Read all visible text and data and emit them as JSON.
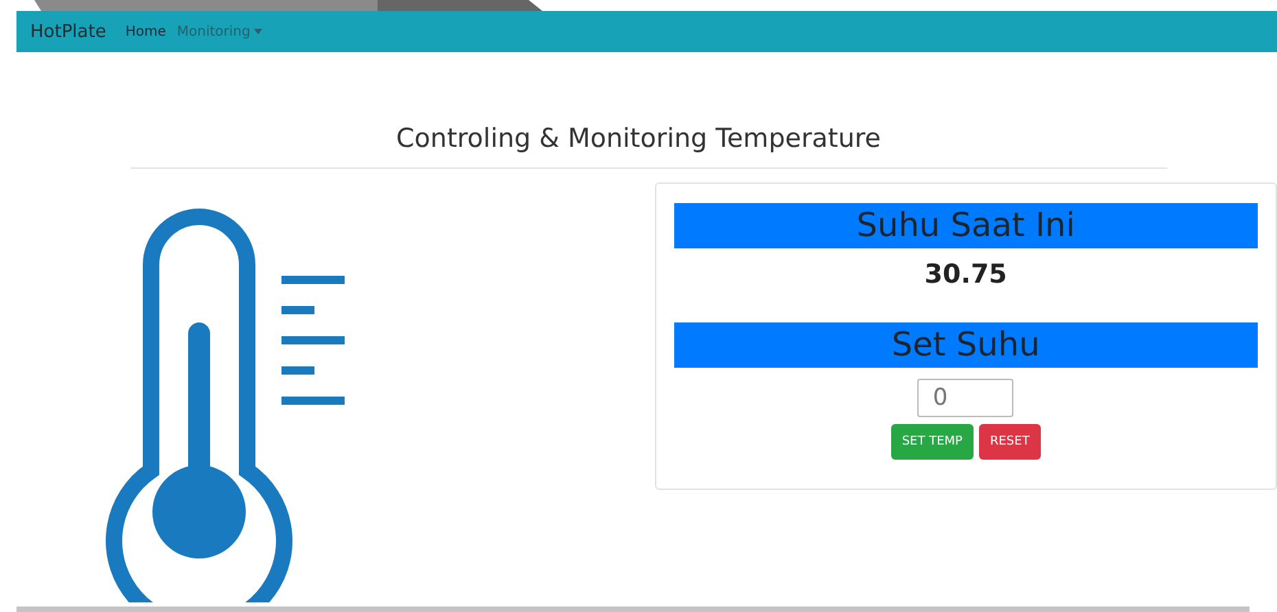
{
  "navbar": {
    "brand": "HotPlate",
    "items": [
      {
        "label": "Home",
        "selected": true,
        "dropdown": false
      },
      {
        "label": "Monitoring",
        "selected": false,
        "dropdown": true
      }
    ]
  },
  "heading": "Controling & Monitoring Temperature",
  "current": {
    "title": "Suhu Saat Ini",
    "value": "30.75"
  },
  "setpoint": {
    "title": "Set Suhu",
    "value": "0"
  },
  "buttons": [
    {
      "label": "SET TEMP",
      "kind": "success"
    },
    {
      "label": "RESET",
      "kind": "danger"
    }
  ]
}
